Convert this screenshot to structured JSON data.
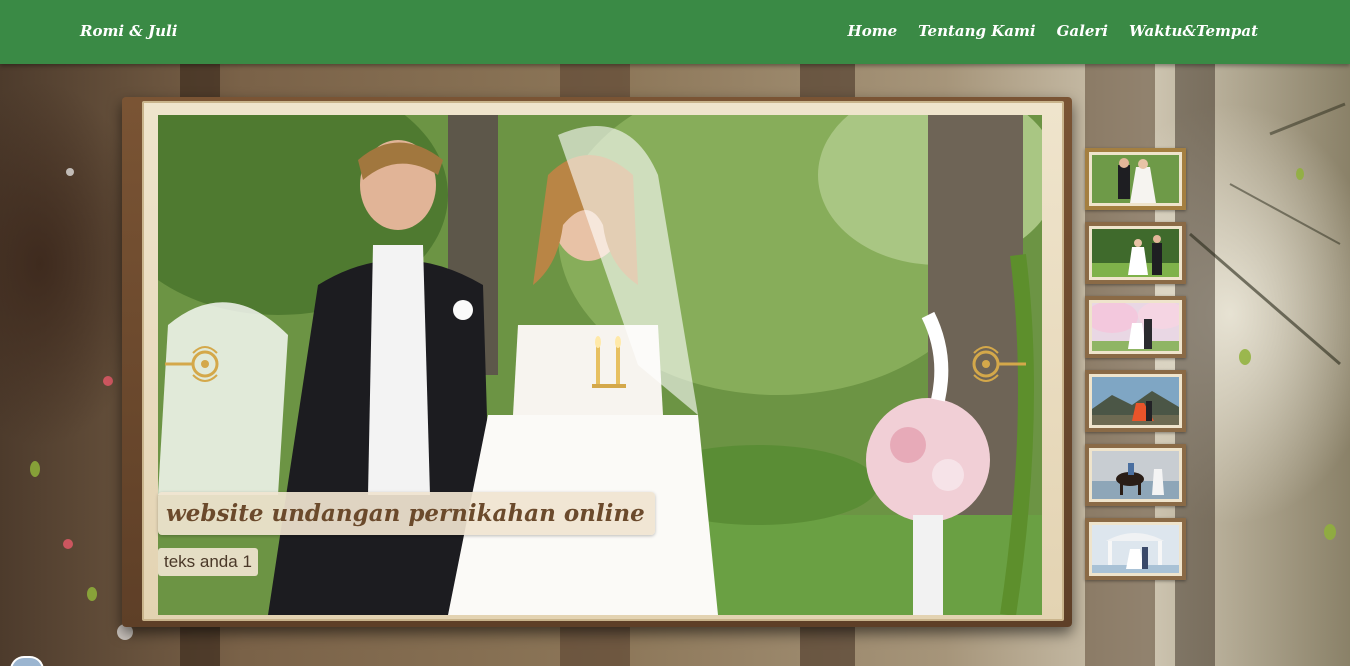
{
  "navbar": {
    "brand": "Romi & Juli",
    "links": [
      "Home",
      "Tentang Kami",
      "Galeri",
      "Waktu&Tempat"
    ]
  },
  "slide": {
    "title": "website undangan pernikahan online",
    "subtitle": "teks anda 1"
  },
  "colors": {
    "nav_bg": "#3a8a45",
    "caption_bg": "#f0e4d0",
    "caption_text": "#6b4a2c",
    "frame_wood": "#7a5434"
  },
  "thumbnails": [
    {
      "name": "thumb-1",
      "scene": "couple-garden-walk"
    },
    {
      "name": "thumb-2",
      "scene": "couple-lawn"
    },
    {
      "name": "thumb-3",
      "scene": "couple-cherry-blossom"
    },
    {
      "name": "thumb-4",
      "scene": "couple-mountains"
    },
    {
      "name": "thumb-5",
      "scene": "couple-horse-beach"
    },
    {
      "name": "thumb-6",
      "scene": "couple-gazebo"
    }
  ]
}
